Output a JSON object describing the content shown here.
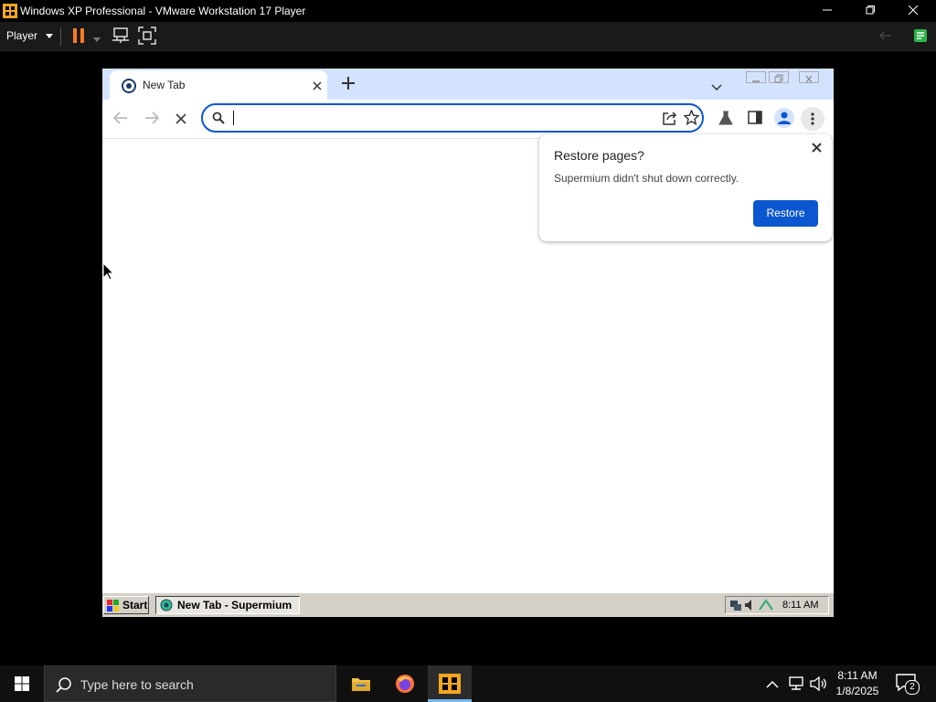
{
  "vmware": {
    "title": "Windows XP Professional - VMware Workstation 17 Player",
    "menu_player": "Player",
    "buttons": {
      "minimize": "—",
      "maximize": "❐",
      "close": "✕"
    }
  },
  "browser": {
    "tab_title": "New Tab",
    "omnibox_value": "",
    "restore_bubble": {
      "title": "Restore pages?",
      "message": "Supermium didn't shut down correctly.",
      "button": "Restore"
    }
  },
  "xp_taskbar": {
    "start": "Start",
    "task_label": "New Tab - Supermium",
    "clock": "8:11 AM"
  },
  "win_taskbar": {
    "search_placeholder": "Type here to search",
    "time": "8:11 AM",
    "date": "1/8/2025",
    "notification_count": "2"
  },
  "colors": {
    "accent_blue": "#0b57d0",
    "tabstrip": "#d3e3fd",
    "xp_face": "#d4d0c8"
  }
}
